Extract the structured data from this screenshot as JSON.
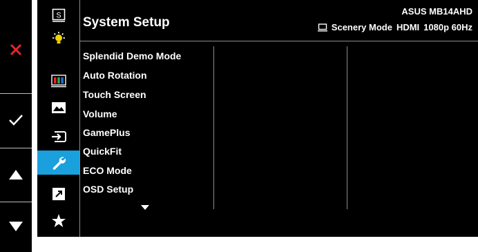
{
  "header": {
    "title": "System Setup",
    "model": "ASUS MB14AHD",
    "mode": "Scenery Mode",
    "input": "HDMI",
    "resolution": "1080p 60Hz"
  },
  "menu": {
    "items": [
      "Splendid Demo Mode",
      "Auto Rotation",
      "Touch Screen",
      "Volume",
      "GamePlus",
      "QuickFit",
      "ECO Mode",
      "OSD Setup"
    ]
  },
  "icons": [
    {
      "name": "splendid-icon",
      "label": "S"
    },
    {
      "name": "blue-light-icon"
    },
    {
      "name": "color-icon"
    },
    {
      "name": "image-icon"
    },
    {
      "name": "input-select-icon"
    },
    {
      "name": "system-setup-icon",
      "active": true
    },
    {
      "name": "shortcut-icon"
    },
    {
      "name": "favorite-icon"
    }
  ],
  "buttons": [
    "close-button",
    "confirm-button",
    "up-button",
    "down-button"
  ],
  "colors": {
    "accent": "#1aa0dc",
    "close": "#e8262a",
    "background": "#000000",
    "text": "#ffffff"
  }
}
